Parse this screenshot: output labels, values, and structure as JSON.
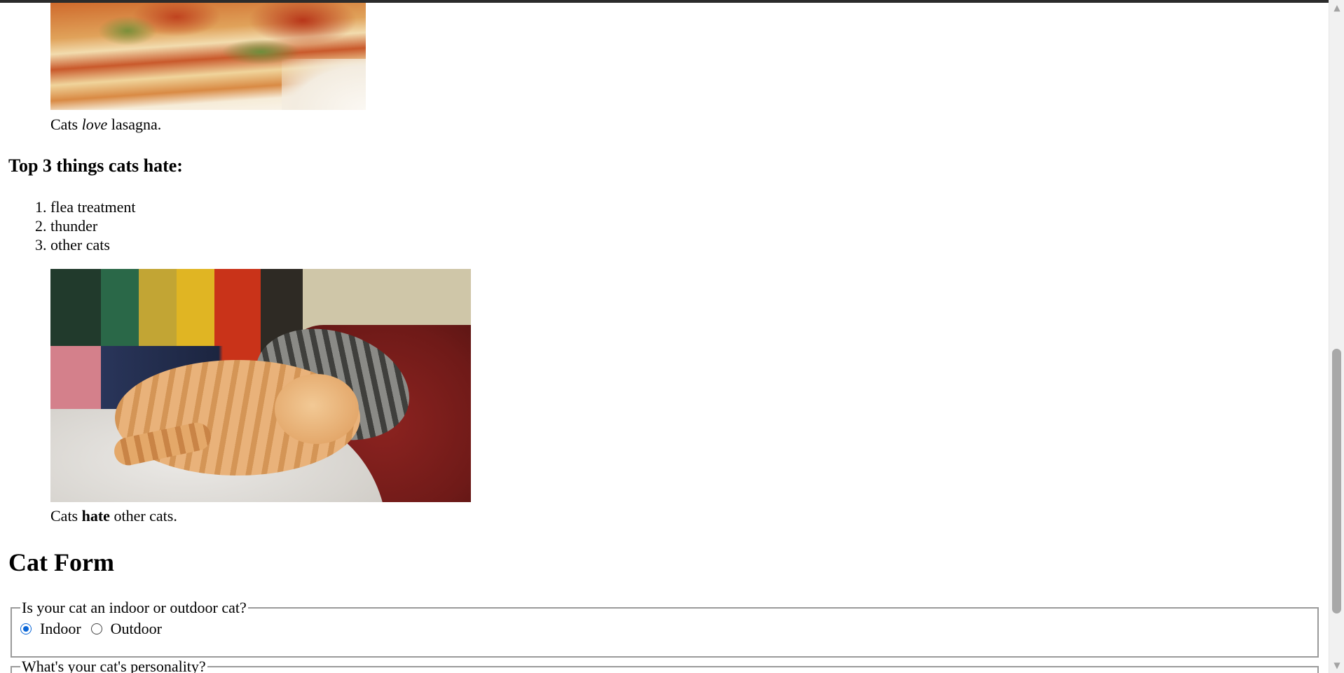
{
  "figures": {
    "lasagna": {
      "caption_pre": "Cats ",
      "caption_em": "love",
      "caption_post": " lasagna."
    },
    "kittens": {
      "caption_pre": "Cats ",
      "caption_strong": "hate",
      "caption_post": " other cats."
    }
  },
  "hate_section": {
    "heading": "Top 3 things cats hate:",
    "items": [
      "flea treatment",
      "thunder",
      "other cats"
    ]
  },
  "form": {
    "title": "Cat Form",
    "indoor_outdoor": {
      "legend": "Is your cat an indoor or outdoor cat?",
      "options": [
        {
          "label": "Indoor",
          "checked": true
        },
        {
          "label": "Outdoor",
          "checked": false
        }
      ]
    },
    "personality": {
      "legend": "What's your cat's personality?"
    }
  },
  "icons": {
    "scroll_up": "scroll-up-arrow-icon",
    "scroll_down": "scroll-down-arrow-icon"
  },
  "colors": {
    "radio_checked": "#0b66d6",
    "fieldset_border": "#9a9a9a",
    "scroll_thumb": "#a8a8a8"
  }
}
